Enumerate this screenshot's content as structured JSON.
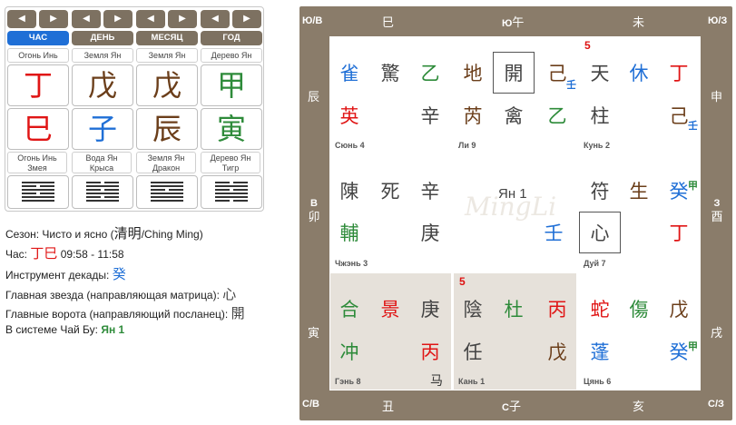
{
  "pillars": [
    {
      "title": "ЧАС",
      "active": true,
      "element": "Огонь Инь",
      "stem": "丁",
      "stem_color": "#e01515",
      "branch": "巳",
      "branch_color": "#e01515",
      "desc1": "Огонь Инь",
      "desc2": "Змея",
      "hex_icon": "hexagram-icon"
    },
    {
      "title": "ДЕНЬ",
      "active": false,
      "element": "Земля Ян",
      "stem": "戊",
      "stem_color": "#6b3e1a",
      "branch": "子",
      "branch_color": "#1f6fd6",
      "desc1": "Вода Ян",
      "desc2": "Крыса",
      "hex_icon": "hexagram-icon"
    },
    {
      "title": "МЕСЯЦ",
      "active": false,
      "element": "Земля Ян",
      "stem": "戊",
      "stem_color": "#6b3e1a",
      "branch": "辰",
      "branch_color": "#6b3e1a",
      "desc1": "Земля Ян",
      "desc2": "Дракон",
      "hex_icon": "hexagram-icon"
    },
    {
      "title": "ГОД",
      "active": false,
      "element": "Дерево Ян",
      "stem": "甲",
      "stem_color": "#2e8b3a",
      "branch": "寅",
      "branch_color": "#2e8b3a",
      "desc1": "Дерево Ян",
      "desc2": "Тигр",
      "hex_icon": "hexagram-icon"
    }
  ],
  "nav": {
    "prev": "◀",
    "next": "▶"
  },
  "info": {
    "season_label": "Сезон:",
    "season_text": "Чисто и ясно (",
    "season_glyph": "清明",
    "season_tail": "/Ching Ming)",
    "hour_label": "Час:",
    "hour_glyph1": "丁",
    "hour_glyph2": "巳",
    "hour_time": "09:58 - 11:58",
    "decade_label": "Инструмент декады:",
    "decade_value": "癸",
    "star_label": "Главная звезда (направляющая матрица):",
    "star_value": "心",
    "gate_label": "Главные ворота (направляющий посланец):",
    "gate_value": "開",
    "system_label": "В системе Чай Бу:",
    "system_value": "Ян 1"
  },
  "chart": {
    "corners": {
      "tl": "Ю/В",
      "tr": "Ю/З",
      "bl": "С/В",
      "br": "С/З"
    },
    "top": [
      "巳",
      "午",
      "未"
    ],
    "top_mid_label": "Ю",
    "bottom": [
      "丑",
      "子",
      "亥"
    ],
    "bottom_mid_label": "С",
    "left": [
      "辰",
      "卯",
      "寅"
    ],
    "left_mid_label": "В",
    "right": [
      "申",
      "酉",
      "戌"
    ],
    "right_mid_label": "З",
    "cells": {
      "xun": {
        "name": "Сюнь 4",
        "g": [
          "雀",
          "驚",
          "乙",
          "英",
          "",
          "辛"
        ]
      },
      "li": {
        "name": "Ли 9",
        "g": [
          "地",
          "開",
          "己",
          "芮",
          "禽",
          "乙"
        ],
        "sub": "壬"
      },
      "kun": {
        "name": "Кунь 2",
        "num": "5",
        "g": [
          "天",
          "休",
          "丁",
          "柱",
          "",
          "己"
        ],
        "sub": "壬"
      },
      "zhen": {
        "name": "Чжэнь 3",
        "g": [
          "陳",
          "死",
          "辛",
          "輔",
          "",
          "庚"
        ]
      },
      "center": {
        "center_text": "Ян 1",
        "g": [
          "壬"
        ]
      },
      "dui": {
        "name": "Дуй 7",
        "g": [
          "符",
          "生",
          "癸",
          "心",
          "",
          "丁"
        ],
        "sub": "甲"
      },
      "gen": {
        "name": "Гэнь 8",
        "g": [
          "合",
          "景",
          "庚",
          "冲",
          "",
          "丙"
        ],
        "mark": "马"
      },
      "kan": {
        "name": "Кань 1",
        "num": "5",
        "g": [
          "陰",
          "杜",
          "丙",
          "任",
          "",
          "戊"
        ]
      },
      "qian": {
        "name": "Цянь 6",
        "g": [
          "蛇",
          "傷",
          "戊",
          "蓬",
          "",
          "癸"
        ],
        "sub": "甲"
      }
    }
  }
}
